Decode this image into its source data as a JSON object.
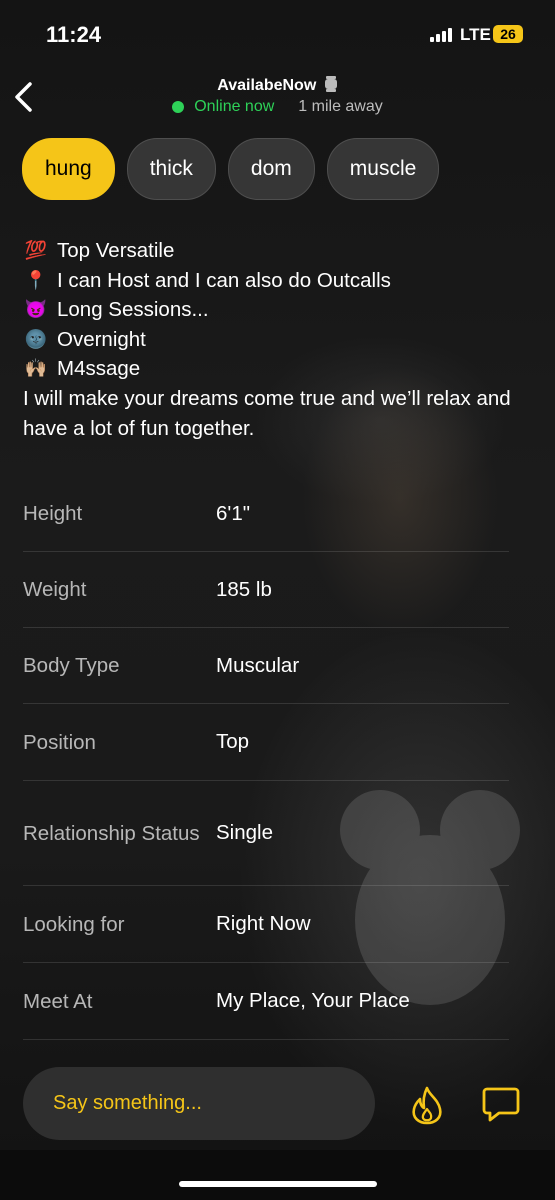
{
  "status_bar": {
    "time": "11:24",
    "network": "LTE",
    "battery": "26"
  },
  "header": {
    "name": "AvailabeNow",
    "online": "Online now",
    "distance": "1 mile away"
  },
  "tags": [
    "hung",
    "thick",
    "dom",
    "muscle"
  ],
  "bio": {
    "lines": [
      {
        "emoji": "💯",
        "text": "Top Versatile"
      },
      {
        "emoji": "📍",
        "text": "I can Host and I can also do Outcalls"
      },
      {
        "emoji": "😈",
        "text": "Long Sessions..."
      },
      {
        "emoji": "🌚",
        "text": "Overnight"
      },
      {
        "emoji": "🙌🏼",
        "text": "M4ssage"
      }
    ],
    "paragraph": "I will make your dreams come true and we’ll relax and have a lot of fun together."
  },
  "details": [
    {
      "label": "Height",
      "value": "6'1\""
    },
    {
      "label": "Weight",
      "value": "185 lb"
    },
    {
      "label": "Body Type",
      "value": "Muscular"
    },
    {
      "label": "Position",
      "value": "Top"
    },
    {
      "label": "Relationship Status",
      "value": "Single"
    },
    {
      "label": "Looking for",
      "value": "Right Now"
    },
    {
      "label": "Meet At",
      "value": "My Place, Your Place"
    }
  ],
  "compose": {
    "placeholder": "Say something..."
  },
  "colors": {
    "accent": "#f5c518",
    "online": "#2ed158"
  }
}
